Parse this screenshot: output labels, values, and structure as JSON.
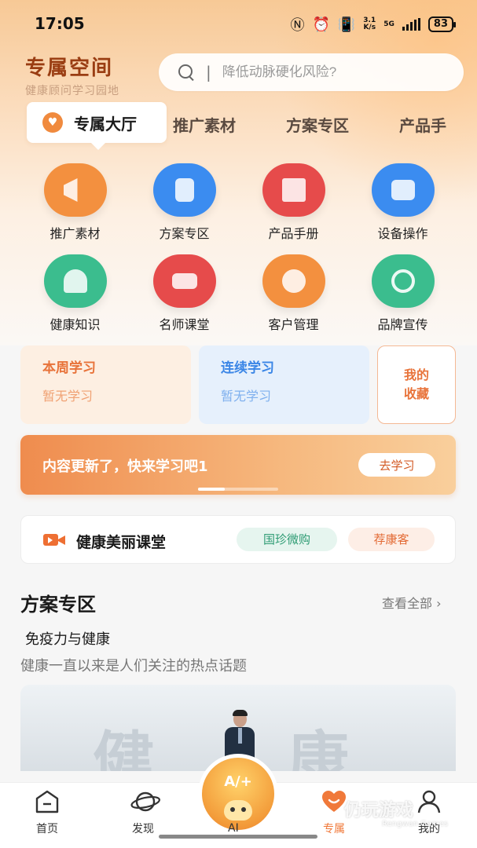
{
  "status_bar": {
    "time": "17:05",
    "net_top": "3.1",
    "net_bottom": "K/s",
    "net_type": "5G",
    "battery": "83"
  },
  "header": {
    "title": "专属空间",
    "subtitle": "健康顾问学习园地"
  },
  "search": {
    "placeholder": "降低动脉硬化风险?"
  },
  "tabs": {
    "active": "专属大厅",
    "items": [
      "推广素材",
      "方案专区",
      "产品手"
    ]
  },
  "grid": [
    {
      "label": "推广素材",
      "icon": "megaphone-icon",
      "color": "#f3903f"
    },
    {
      "label": "方案专区",
      "icon": "document-icon",
      "color": "#3b8cf0"
    },
    {
      "label": "产品手册",
      "icon": "book-icon",
      "color": "#e64b4b"
    },
    {
      "label": "设备操作",
      "icon": "server-icon",
      "color": "#3b8cf0"
    },
    {
      "label": "健康知识",
      "icon": "reading-icon",
      "color": "#3bbd8e"
    },
    {
      "label": "名师课堂",
      "icon": "video-icon",
      "color": "#e64b4b"
    },
    {
      "label": "客户管理",
      "icon": "users-icon",
      "color": "#f3903f"
    },
    {
      "label": "品牌宣传",
      "icon": "brand-logo-icon",
      "color": "#3bbd8e"
    }
  ],
  "study": {
    "weekly": {
      "title": "本周学习",
      "value": "暂无学习"
    },
    "continuous": {
      "title": "连续学习",
      "value": "暂无学习"
    },
    "favorites_line1": "我的",
    "favorites_line2": "收藏"
  },
  "banner": {
    "text": "内容更新了，快来学习吧1",
    "button": "去学习"
  },
  "classroom": {
    "title": "健康美丽课堂",
    "chip1": "国珍微购",
    "chip2": "荐康客"
  },
  "section": {
    "title": "方案专区",
    "more": "查看全部 ›",
    "item_title": "免疫力与健康",
    "item_desc": "健康一直以来是人们关注的热点话题",
    "thumb_chars": [
      "健",
      "康"
    ]
  },
  "nav": {
    "home": "首页",
    "discover": "发现",
    "ai": "AI",
    "ai_badge": "A/+",
    "exclusive": "专属",
    "mine": "我的"
  },
  "watermark": {
    "line1": "仍玩游戏",
    "line2": "Rengwan Games"
  }
}
